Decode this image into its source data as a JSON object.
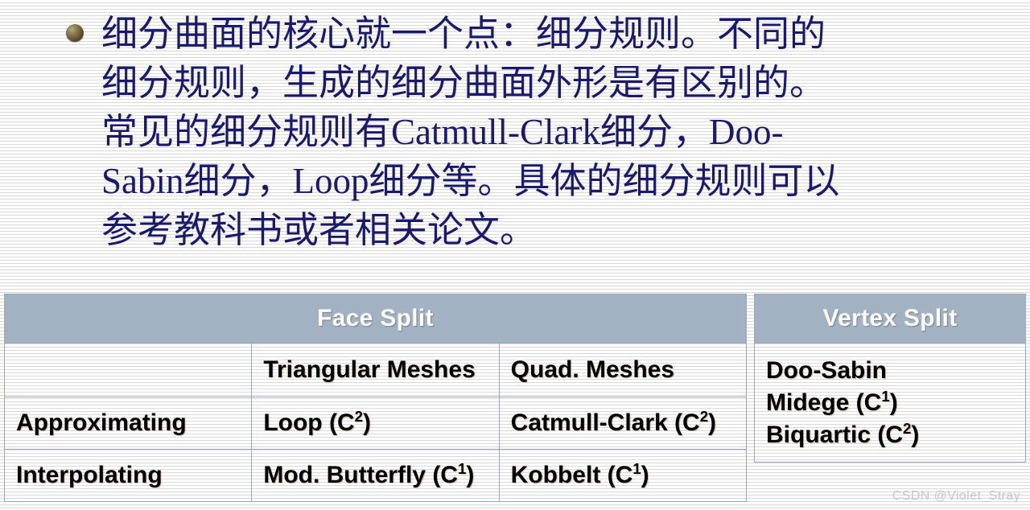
{
  "slide": {
    "bullet": {
      "marker": "sphere-bullet",
      "text": "细分曲面的核心就一个点：细分规则。不同的\n细分规则，生成的细分曲面外形是有区别的。\n常见的细分规则有Catmull-Clark细分，Doo-\nSabin细分，Loop细分等。具体的细分规则可以\n参考教科书或者相关论文。"
    },
    "colors": {
      "text_navy": "#191970",
      "header_fill": "#a3b2c3",
      "header_text": "#ffffff",
      "border": "#9aaabd",
      "watermark": "#c6c6c6"
    },
    "table_face": {
      "header": "Face Split",
      "column_headers": [
        "",
        "Triangular Meshes",
        "Quad. Meshes"
      ],
      "rows": [
        {
          "label": "Approximating",
          "triangular": "Loop (C",
          "triangular_sup": "2",
          "triangular_tail": ")",
          "quad": "Catmull-Clark (C",
          "quad_sup": "2",
          "quad_tail": ")"
        },
        {
          "label": "Interpolating",
          "triangular": "Mod. Butterfly (C",
          "triangular_sup": "1",
          "triangular_tail": ")",
          "quad": "Kobbelt (C",
          "quad_sup": "1",
          "quad_tail": ")"
        }
      ]
    },
    "table_vertex": {
      "header": "Vertex Split",
      "lines": [
        {
          "text": "Doo-Sabin",
          "sup": "",
          "tail": ""
        },
        {
          "text": "Midege (C",
          "sup": "1",
          "tail": ")"
        },
        {
          "text": "Biquartic (C",
          "sup": "2",
          "tail": ")"
        }
      ]
    },
    "watermark": "CSDN @Violet_Stray"
  }
}
